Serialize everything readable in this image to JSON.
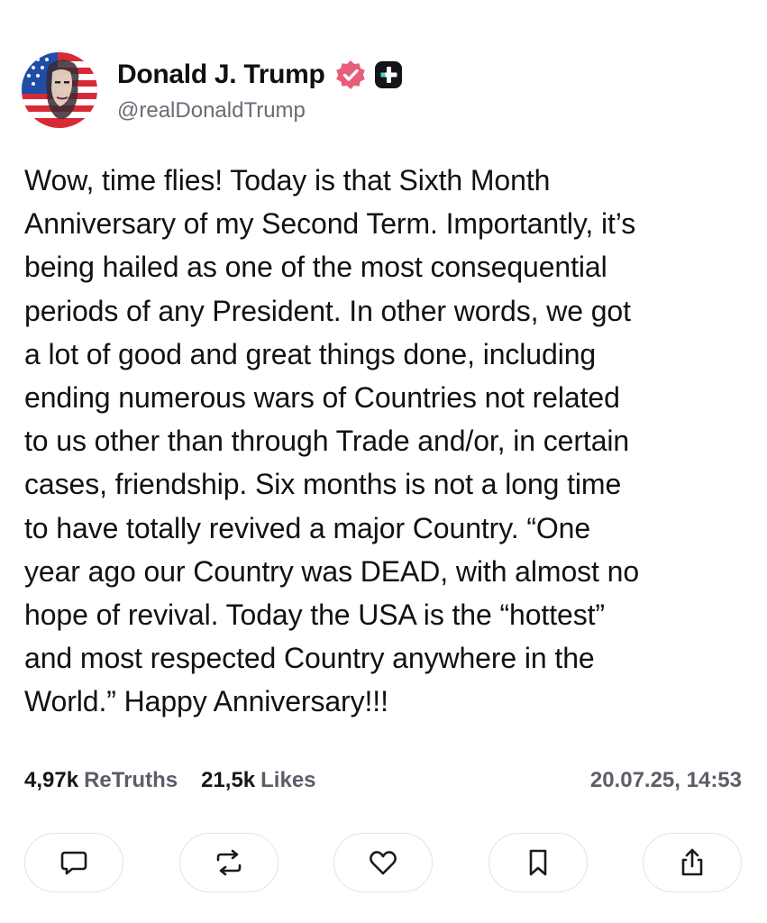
{
  "author": {
    "display_name": "Donald J. Trump",
    "handle": "@realDonaldTrump",
    "avatar_icon": "flag-portrait-avatar",
    "verified_icon": "verified-badge-icon",
    "plus_icon": "plus-badge-icon"
  },
  "post": {
    "text": "Wow, time flies! Today is that Sixth Month\nAnniversary of my Second Term. Importantly, it’s\nbeing hailed as one of the most consequential\nperiods of any President. In other words, we got\na lot of good and great things done, including\nending numerous wars of Countries not related\nto us other than through Trade and/or, in certain\ncases, friendship. Six months is not a long time\nto have totally revived a major Country. “One\nyear ago our Country was DEAD, with almost no\nhope of revival. Today the USA is the “hottest”\nand most respected Country anywhere in the\nWorld.” Happy Anniversary!!!"
  },
  "stats": {
    "retruths_count": "4,97k",
    "retruths_label": "ReTruths",
    "likes_count": "21,5k",
    "likes_label": "Likes",
    "timestamp": "20.07.25, 14:53"
  },
  "actions": [
    {
      "name": "reply-button",
      "icon": "comment-icon"
    },
    {
      "name": "retruth-button",
      "icon": "repost-icon"
    },
    {
      "name": "like-button",
      "icon": "heart-icon"
    },
    {
      "name": "bookmark-button",
      "icon": "bookmark-icon"
    },
    {
      "name": "share-button",
      "icon": "share-icon"
    }
  ],
  "colors": {
    "verified_badge": "#e85d7a",
    "accent": "#101014",
    "muted_text": "#5d5d6a",
    "button_border": "#e3e3ea"
  }
}
